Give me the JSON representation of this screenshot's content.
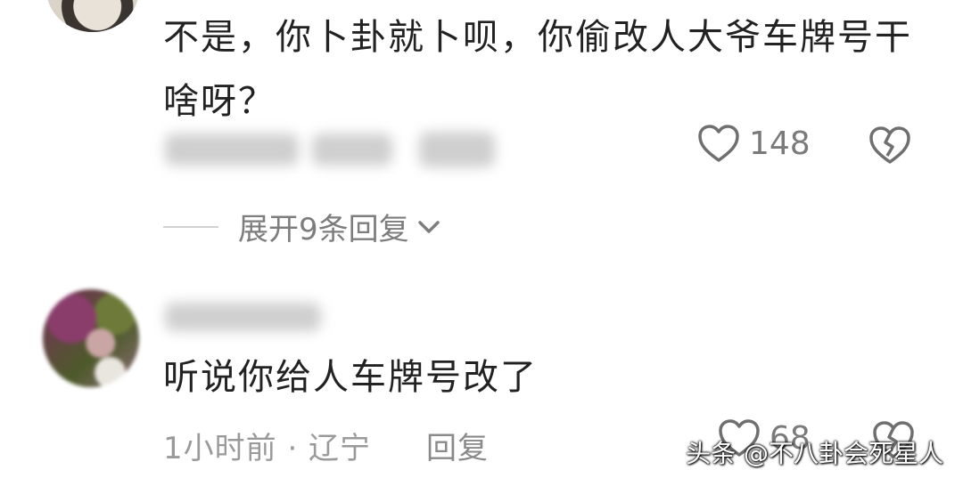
{
  "comment1": {
    "text": "不是，你卜卦就卜呗，你偷改人大爷车牌号干啥呀？",
    "like_count": "148"
  },
  "expand_replies_label": "展开9条回复",
  "comment2": {
    "text": "听说你给人车牌号改了",
    "time_location": "1小时前 · 辽宁",
    "reply_label": "回复",
    "like_count": "68"
  },
  "watermark": "头条 @不八卦会死星人"
}
